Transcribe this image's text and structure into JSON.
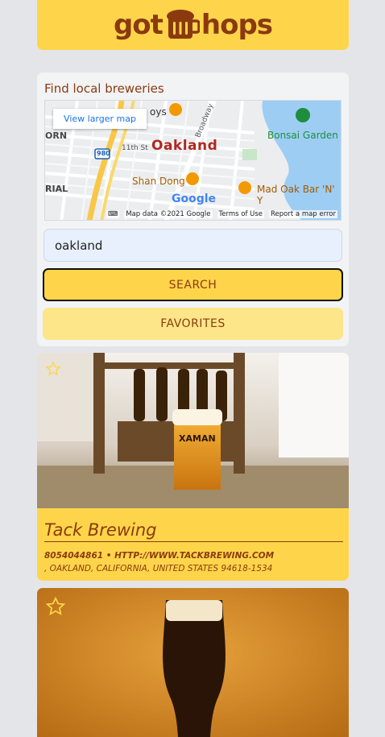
{
  "header": {
    "logo_left": "got",
    "logo_right": "hops"
  },
  "search": {
    "label": "Find local breweries",
    "input_value": "oakland",
    "search_button": "SEARCH",
    "favorites_button": "FAVORITES"
  },
  "map": {
    "larger_map_link": "View larger map",
    "city": "Oakland",
    "places": [
      "Bonsai Garden",
      "Shan Dong",
      "Mad Oak Bar 'N' Y",
      "oys"
    ],
    "streets": [
      "11th St",
      "Broadway",
      "980",
      "ORN",
      "RIAL"
    ],
    "brand": "Google",
    "footer": [
      "Map data ©2021 Google",
      "Terms of Use",
      "Report a map error"
    ]
  },
  "results": [
    {
      "name": "Tack Brewing",
      "phone_url": "8054044861 • HTTP://WWW.TACKBREWING.COM",
      "address": ", OAKLAND, CALIFORNIA, UNITED STATES 94618-1534",
      "favorited": false
    },
    {
      "name": "",
      "favorited": false
    }
  ],
  "colors": {
    "accent": "#fed54a",
    "brand_text": "#8b3a0f",
    "light_accent": "#fde68a"
  }
}
